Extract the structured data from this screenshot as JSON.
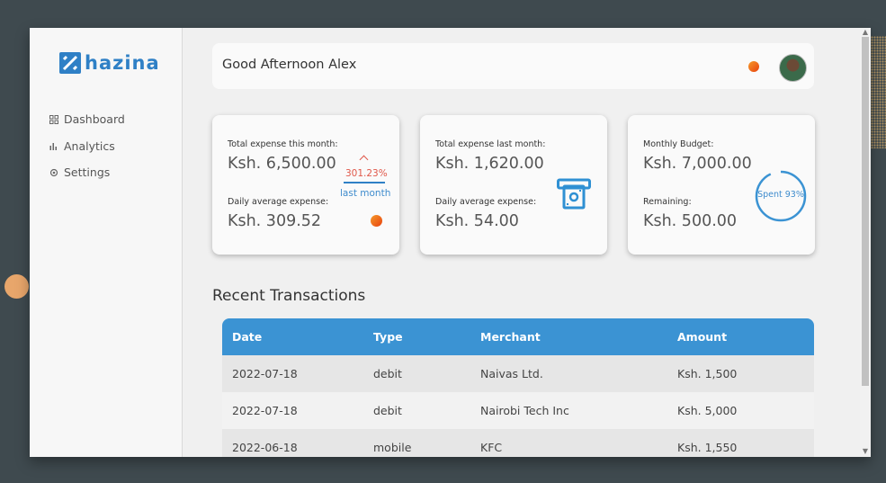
{
  "app": {
    "logo_text": "hazina",
    "brand_color": "#2f80c6"
  },
  "sidebar": {
    "items": [
      {
        "label": "Dashboard",
        "icon": "dashboard-icon"
      },
      {
        "label": "Analytics",
        "icon": "analytics-icon"
      },
      {
        "label": "Settings",
        "icon": "settings-icon"
      }
    ]
  },
  "header": {
    "greeting": "Good Afternoon Alex"
  },
  "cards": {
    "this_month": {
      "label": "Total expense this month:",
      "value": "Ksh. 6,500.00",
      "daily_label": "Daily average expense:",
      "daily_value": "Ksh. 309.52",
      "trend_pct": "301.23%",
      "trend_label": "last month",
      "trend_color": "#e0584a"
    },
    "last_month": {
      "label": "Total expense last month:",
      "value": "Ksh. 1,620.00",
      "daily_label": "Daily average expense:",
      "daily_value": "Ksh. 54.00",
      "icon": "atm-icon"
    },
    "budget": {
      "label": "Monthly Budget:",
      "value": "Ksh. 7,000.00",
      "remaining_label": "Remaining:",
      "remaining_value": "Ksh. 500.00",
      "spent_text": "Spent 93%",
      "spent_fraction": 0.93
    }
  },
  "transactions": {
    "title": "Recent Transactions",
    "columns": [
      "Date",
      "Type",
      "Merchant",
      "Amount"
    ],
    "rows": [
      [
        "2022-07-18",
        "debit",
        "Naivas Ltd.",
        "Ksh. 1,500"
      ],
      [
        "2022-07-18",
        "debit",
        "Nairobi Tech Inc",
        "Ksh. 5,000"
      ],
      [
        "2022-06-18",
        "mobile",
        "KFC",
        "Ksh. 1,550"
      ]
    ],
    "header_color": "#3b93d3"
  }
}
